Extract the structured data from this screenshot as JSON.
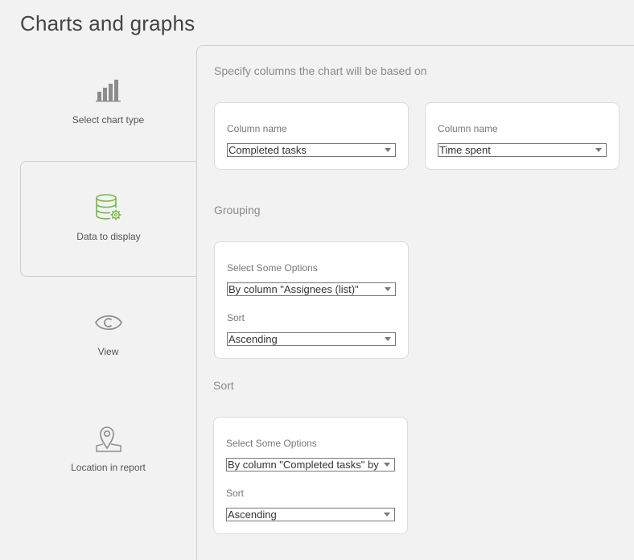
{
  "page": {
    "title": "Charts and graphs"
  },
  "steps": [
    {
      "label": "Select chart type",
      "icon": "bar-chart-icon"
    },
    {
      "label": "Data to display",
      "icon": "database-gear-icon",
      "active": true
    },
    {
      "label": "View",
      "icon": "eye-icon"
    },
    {
      "label": "Location in report",
      "icon": "location-pin-icon"
    }
  ],
  "columns_section": {
    "title": "Specify columns the chart will be based on",
    "col1": {
      "label": "Column name",
      "value": "Completed tasks"
    },
    "col2": {
      "label": "Column name",
      "value": "Time spent"
    }
  },
  "grouping_section": {
    "title": "Grouping",
    "options_label": "Select Some Options",
    "options_value": "By column \"Assignees (list)\"",
    "sort_label": "Sort",
    "sort_value": "Ascending"
  },
  "sort_section": {
    "title": "Sort",
    "options_label": "Select Some Options",
    "options_value": "By column \"Completed tasks\" by",
    "sort_label": "Sort",
    "sort_value": "Ascending"
  },
  "colors": {
    "accent": "#7ab648",
    "icon_gray": "#8c8c8c"
  }
}
